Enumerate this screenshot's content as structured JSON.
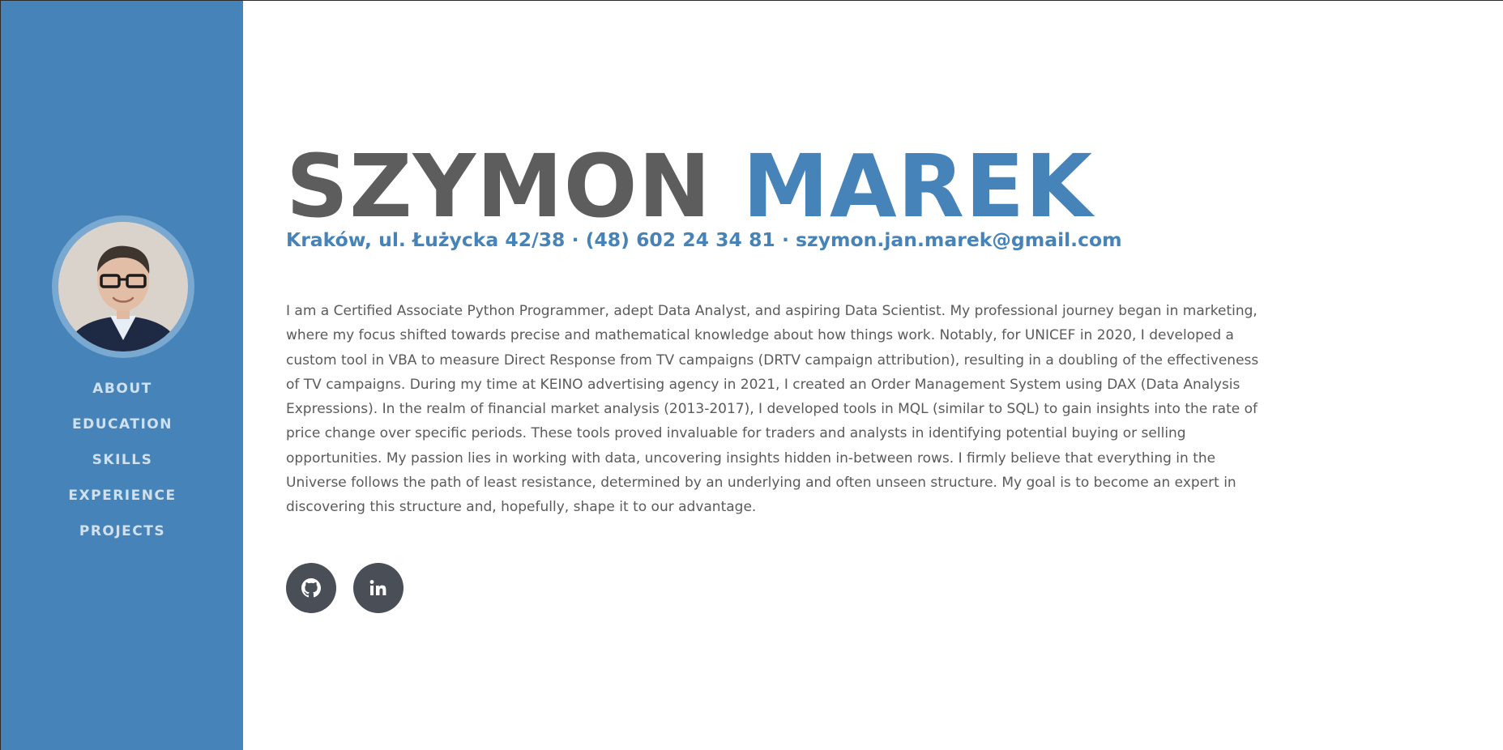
{
  "profile": {
    "first_name": "SZYMON",
    "last_name": "MAREK",
    "contact": "Kraków, ul. Łużycka 42/38 · (48) 602 24 34 81 · szymon.jan.marek@gmail.com",
    "bio": "I am a Certified Associate Python Programmer, adept Data Analyst, and aspiring Data Scientist. My professional journey began in marketing, where my focus shifted towards precise and mathematical knowledge about how things work. Notably, for UNICEF in 2020, I developed a custom tool in VBA to measure Direct Response from TV campaigns (DRTV campaign attribution), resulting in a doubling of the effectiveness of TV campaigns. During my time at KEINO advertising agency in 2021, I created an Order Management System using DAX (Data Analysis Expressions). In the realm of financial market analysis (2013-2017), I developed tools in MQL (similar to SQL) to gain insights into the rate of price change over specific periods. These tools proved invaluable for traders and analysts in identifying potential buying or selling opportunities. My passion lies in working with data, uncovering insights hidden in-between rows. I firmly believe that everything in the Universe follows the path of least resistance, determined by an underlying and often unseen structure. My goal is to become an expert in discovering this structure and, hopefully, shape it to our advantage."
  },
  "sidebar": {
    "avatar_icon": "profile-photo",
    "nav": [
      {
        "label": "ABOUT"
      },
      {
        "label": "EDUCATION"
      },
      {
        "label": "SKILLS"
      },
      {
        "label": "EXPERIENCE"
      },
      {
        "label": "PROJECTS"
      }
    ]
  },
  "socials": [
    {
      "icon": "github-icon"
    },
    {
      "icon": "linkedin-icon"
    }
  ],
  "colors": {
    "primary": "#4583b9",
    "heading_gray": "#5d5d5d",
    "text_gray": "#5a5a5a",
    "nav_text": "#cfe0ef",
    "social_bg": "#494e57"
  }
}
